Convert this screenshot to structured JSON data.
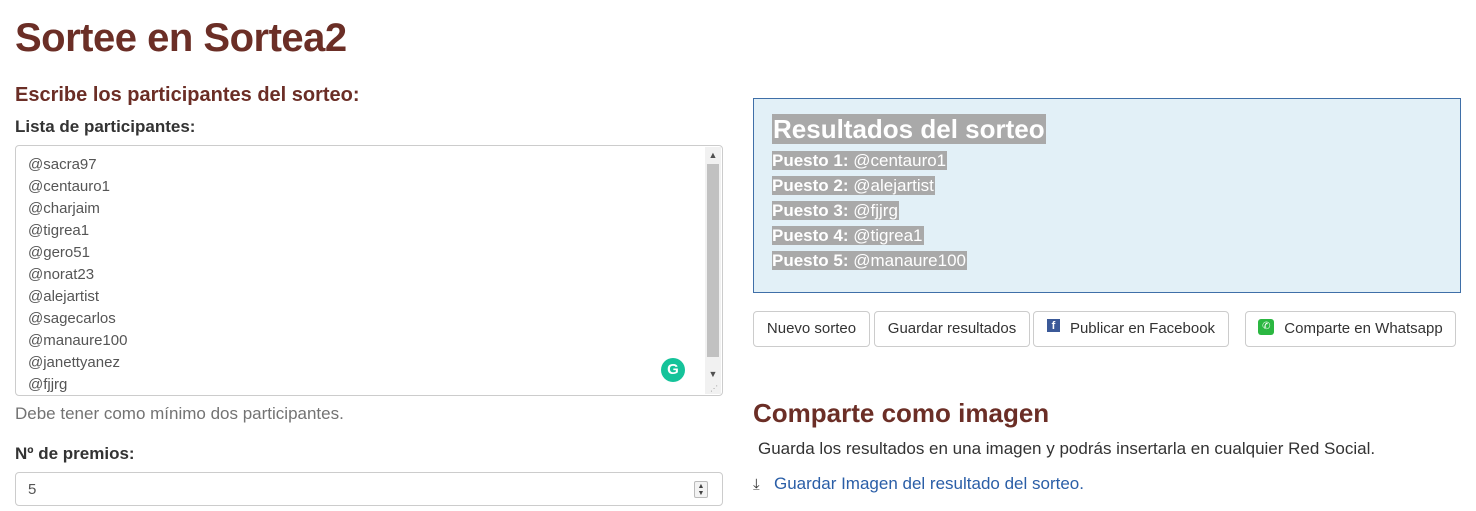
{
  "page": {
    "title": "Sortee en Sortea2",
    "subtitle": "Escribe los participantes del sorteo:"
  },
  "participants": {
    "label": "Lista de participantes:",
    "items": [
      "@sacra97",
      "@centauro1",
      "@charjaim",
      "@tigrea1",
      "@gero51",
      "@norat23",
      "@alejartist",
      "@sagecarlos",
      "@manaure100",
      "@janettyanez",
      "@fjjrg"
    ],
    "help": "Debe tener como mínimo dos participantes."
  },
  "prizes": {
    "label": "Nº de premios:",
    "value": "5"
  },
  "results": {
    "title": "Resultados del sorteo",
    "items": [
      {
        "place": "Puesto 1:",
        "winner": "@centauro1"
      },
      {
        "place": "Puesto 2:",
        "winner": "@alejartist"
      },
      {
        "place": "Puesto 3:",
        "winner": "@fjjrg"
      },
      {
        "place": "Puesto 4:",
        "winner": "@tigrea1"
      },
      {
        "place": "Puesto 5:",
        "winner": "@manaure100"
      }
    ]
  },
  "actions": {
    "new": "Nuevo sorteo",
    "save": "Guardar resultados",
    "facebook": "Publicar en Facebook",
    "whatsapp": "Comparte en Whatsapp"
  },
  "share": {
    "title": "Comparte como imagen",
    "description": "Guarda los resultados en una imagen y podrás insertarla en cualquier Red Social.",
    "download_link": "Guardar Imagen del resultado del sorteo."
  },
  "icons": {
    "facebook": "facebook-icon",
    "whatsapp": "whatsapp-icon",
    "download": "download-icon",
    "grammarly": "grammarly-icon"
  },
  "colors": {
    "heading": "#6b2e26",
    "results_bg": "#e2f0f7",
    "results_border": "#3f6fa8",
    "link": "#2a5ea7"
  }
}
